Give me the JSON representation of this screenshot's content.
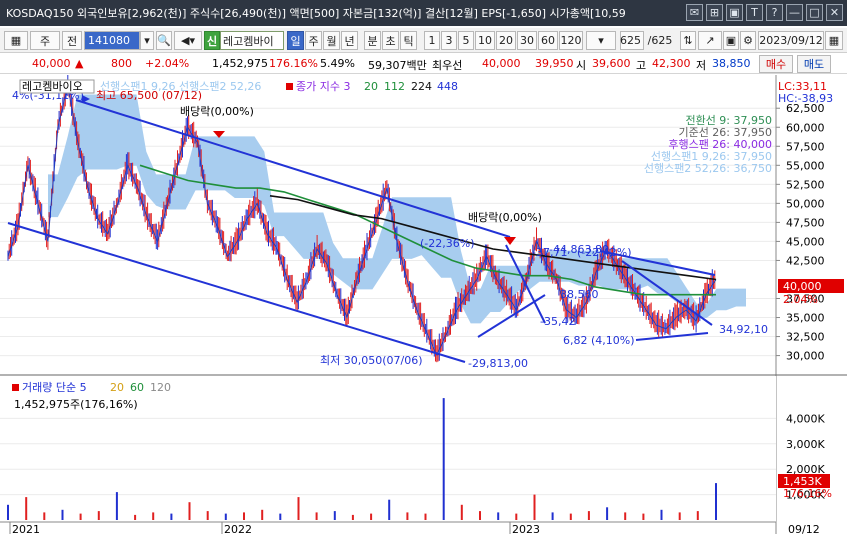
{
  "window": {
    "title": "KOSDAQ150 외국인보유[2,962(천)] 주식수[26,490(천)] 액면[500] 자본금[132(억)] 결산[12월] EPS[-1,650] 시가총액[10,59",
    "controls": [
      "✉",
      "⊞",
      "▣",
      "T",
      "?",
      "—",
      "□",
      "✕"
    ]
  },
  "toolbar": {
    "stock_type": "주",
    "code_label": "전",
    "code": "141080",
    "name_label": "신",
    "name": "레고켐바이",
    "periods": [
      "일",
      "주",
      "월",
      "년",
      "분",
      "초",
      "틱"
    ],
    "intervals": [
      "1",
      "3",
      "5",
      "10",
      "20",
      "30",
      "60",
      "120"
    ],
    "count": "625",
    "count_total": "/625",
    "date": "2023/09/12"
  },
  "quote": {
    "price": "40,000",
    "change": "800",
    "change_pct": "+2.04%",
    "volume": "1,452,975",
    "vol_ratio": "176.16%",
    "turnover": "5.49%",
    "amount": "59,307백만",
    "best_ask_label": "최우선",
    "best_ask": "40,000",
    "best_bid": "39,950",
    "open_label": "시",
    "open": "39,600",
    "high_label": "고",
    "high": "42,300",
    "low_label": "저",
    "low": "38,850",
    "sell_button": "매수",
    "buy_button": "매도"
  },
  "chart_labels": {
    "legend_name": "레고켐바이오",
    "legend_ichimoku": "선행스팬1 9,26  선행스팬2 52,26",
    "legend_close": "종가 지수 3",
    "legend_ma": [
      "20",
      "112",
      "224",
      "448"
    ],
    "top_left_pct": "4%(-31,11%)",
    "max_label": "최고 65,500 (07/12)",
    "div1": "배당락(0,00%)",
    "div2": "배당락(0,00%)",
    "min_label": "최저 30,050(07/06)",
    "line_val_1": "-29,813,00",
    "ann_1": "(-22,36%)",
    "ann_2": "-37,71",
    "ann_3": "-44,863,80",
    "ann_4": "(-22,42%)",
    "ann_5": "-35,42",
    "ann_6": "38,560",
    "ann_7": "6,82 (4,10%)",
    "ann_8": "34,92,10",
    "lc": "LC:33,11",
    "hc": "HC:-38,93",
    "ichi_info": [
      {
        "text": "전환선 9: 37,950",
        "color": "#2f8f55"
      },
      {
        "text": "기준선 26: 37,950",
        "color": "#606060"
      },
      {
        "text": "후행스팬 26: 40,000",
        "color": "#8a2be2"
      },
      {
        "text": "선행스팬1 9,26: 37,950",
        "color": "#9cc8ef"
      },
      {
        "text": "선행스팬2 52,26: 36,750",
        "color": "#9cc8ef"
      }
    ],
    "price_ticks": [
      "62,500",
      "60,000",
      "57,500",
      "55,000",
      "52,500",
      "50,000",
      "47,500",
      "45,000",
      "42,500",
      "37,500",
      "35,000",
      "32,500",
      "30,000"
    ],
    "price_tag": "40,000",
    "price_tag_pct": "2.04%",
    "volume_legend": "거래량  단순 5",
    "volume_ma": [
      "20",
      "60",
      "120"
    ],
    "volume_value": "1,452,975주(176,16%)",
    "vol_ticks": [
      "4,000K",
      "3,000K",
      "2,000K",
      "1,000K"
    ],
    "vol_tag": "1,453K",
    "vol_tag_pct": "176,16%",
    "x_labels": [
      "2021",
      "2022",
      "2023"
    ],
    "x_end": "09/12"
  },
  "chart_data": {
    "type": "line",
    "title": "",
    "xlabel": "",
    "ylabel": "",
    "ylim": [
      28500,
      64500
    ],
    "x_range": [
      "2021",
      "2023/09/12"
    ],
    "series": [
      {
        "name": "종가",
        "values": [
          43000,
          47000,
          55000,
          50000,
          45000,
          60000,
          65500,
          58000,
          52000,
          48000,
          46000,
          50000,
          55000,
          52000,
          48000,
          45000,
          50000,
          55000,
          60000,
          58000,
          50000,
          47000,
          43000,
          45000,
          48000,
          50000,
          46000,
          44000,
          40000,
          37000,
          40000,
          44000,
          42000,
          38000,
          35000,
          40000,
          44000,
          48000,
          52000,
          45000,
          40000,
          36000,
          33000,
          30050,
          33000,
          36000,
          38000,
          40000,
          43000,
          40000,
          38000,
          36000,
          40000,
          45000,
          42000,
          40000,
          36000,
          35000,
          37000,
          41000,
          44000,
          42000,
          40000,
          38000,
          36000,
          34000,
          33500,
          35000,
          36000,
          34500,
          38000,
          40000
        ]
      },
      {
        "name": "112",
        "values": [
          55000,
          54000,
          53000,
          52500,
          52000,
          52000,
          51500,
          50500,
          49500,
          48500,
          47000,
          45500,
          44000,
          42500,
          41500,
          41000,
          40500,
          40500,
          40000,
          39000,
          38500,
          38000,
          38000,
          38000,
          38000
        ]
      },
      {
        "name": "224",
        "values": [
          51000,
          50500,
          49500,
          48500,
          48000,
          47000,
          46000,
          45000,
          44000,
          43500,
          43000,
          42500,
          42000,
          41500,
          41000,
          40500,
          40000
        ]
      }
    ],
    "volume": {
      "values_k": [
        600,
        900,
        300,
        400,
        250,
        350,
        1100,
        200,
        300,
        250,
        700,
        350,
        250,
        300,
        400,
        250,
        900,
        300,
        350,
        200,
        250,
        800,
        300,
        250,
        4800,
        600,
        350,
        300,
        250,
        1000,
        300,
        250,
        350,
        500,
        300,
        250,
        400,
        300,
        350,
        1453
      ],
      "ylim": [
        0,
        5000
      ]
    }
  }
}
